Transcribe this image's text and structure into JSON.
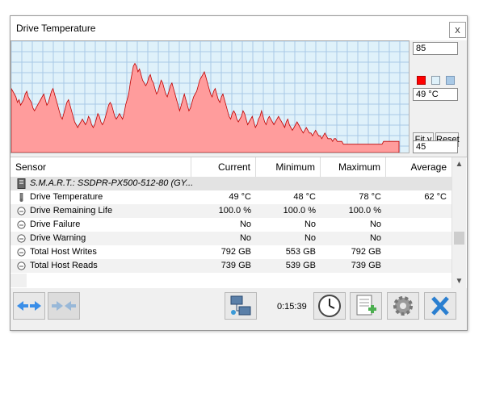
{
  "window": {
    "title": "Drive Temperature",
    "close_label": "x"
  },
  "side_panel": {
    "max_value": "85",
    "current_value": "49 °C",
    "min_value": "45",
    "fit_y_label": "Fit y",
    "reset_label": "Reset",
    "swatches": [
      "#ff0000",
      "#dff1fa",
      "#a9c9e6"
    ]
  },
  "chart_data": {
    "type": "area",
    "color": "#ff9c9c",
    "line_color": "#c00000",
    "ylim": [
      45,
      85
    ],
    "values": [
      68,
      67,
      66,
      65,
      63,
      64,
      62,
      63,
      64,
      66,
      67,
      65,
      64,
      63,
      61,
      60,
      61,
      62,
      63,
      64,
      65,
      66,
      64,
      62,
      63,
      65,
      67,
      68,
      66,
      64,
      62,
      60,
      58,
      57,
      59,
      61,
      63,
      64,
      62,
      60,
      58,
      56,
      55,
      54,
      55,
      56,
      57,
      56,
      55,
      56,
      58,
      57,
      55,
      54,
      55,
      57,
      59,
      58,
      56,
      55,
      56,
      58,
      60,
      62,
      63,
      62,
      60,
      58,
      57,
      58,
      59,
      58,
      57,
      59,
      62,
      64,
      66,
      70,
      73,
      76,
      77,
      76,
      74,
      75,
      73,
      71,
      70,
      69,
      70,
      72,
      73,
      71,
      70,
      68,
      66,
      67,
      69,
      71,
      70,
      68,
      66,
      65,
      67,
      69,
      70,
      68,
      66,
      64,
      62,
      60,
      62,
      64,
      66,
      64,
      62,
      60,
      61,
      63,
      65,
      66,
      67,
      69,
      71,
      72,
      73,
      74,
      72,
      70,
      68,
      66,
      65,
      67,
      68,
      66,
      64,
      63,
      65,
      66,
      64,
      62,
      60,
      58,
      57,
      59,
      60,
      59,
      57,
      56,
      57,
      58,
      60,
      59,
      57,
      55,
      56,
      57,
      58,
      56,
      54,
      55,
      57,
      58,
      60,
      58,
      56,
      55,
      57,
      58,
      57,
      56,
      55,
      56,
      57,
      58,
      57,
      56,
      55,
      54,
      56,
      57,
      55,
      54,
      53,
      54,
      55,
      56,
      55,
      54,
      53,
      52,
      53,
      54,
      53,
      52,
      52,
      51,
      52,
      53,
      52,
      51,
      51,
      50,
      51,
      52,
      51,
      50,
      50,
      50,
      49,
      50,
      50,
      49,
      49,
      49,
      49,
      48,
      48,
      48,
      48,
      48,
      48,
      48,
      48,
      48,
      48,
      48,
      48,
      48,
      48,
      48,
      48,
      48,
      48,
      48,
      48,
      48,
      48,
      48,
      48,
      48,
      48,
      49,
      49,
      49,
      49,
      49,
      49,
      49,
      49,
      49,
      49,
      49
    ]
  },
  "table": {
    "headers": {
      "sensor": "Sensor",
      "current": "Current",
      "minimum": "Minimum",
      "maximum": "Maximum",
      "average": "Average"
    },
    "group": {
      "label": "S.M.A.R.T.: SSDPR-PX500-512-80 (GY..."
    },
    "rows": [
      {
        "sensor": "Drive Temperature",
        "current": "49 °C",
        "minimum": "48 °C",
        "maximum": "78 °C",
        "average": "62 °C",
        "icon": "thermometer-icon"
      },
      {
        "sensor": "Drive Remaining Life",
        "current": "100.0 %",
        "minimum": "100.0 %",
        "maximum": "100.0 %",
        "average": "",
        "icon": "sensor-dial-icon"
      },
      {
        "sensor": "Drive Failure",
        "current": "No",
        "minimum": "No",
        "maximum": "No",
        "average": "",
        "icon": "sensor-dial-icon"
      },
      {
        "sensor": "Drive Warning",
        "current": "No",
        "minimum": "No",
        "maximum": "No",
        "average": "",
        "icon": "sensor-dial-icon"
      },
      {
        "sensor": "Total Host Writes",
        "current": "792 GB",
        "minimum": "553 GB",
        "maximum": "792 GB",
        "average": "",
        "icon": "sensor-dial-icon"
      },
      {
        "sensor": "Total Host Reads",
        "current": "739 GB",
        "minimum": "539 GB",
        "maximum": "739 GB",
        "average": "",
        "icon": "sensor-dial-icon"
      }
    ]
  },
  "toolbar": {
    "timer": "0:15:39",
    "buttons": [
      "navigate-arrows-icon",
      "navigate-arrows-disabled-icon",
      "network-icon",
      "clock-icon",
      "add-report-icon",
      "settings-gear-icon",
      "close-x-icon"
    ]
  }
}
